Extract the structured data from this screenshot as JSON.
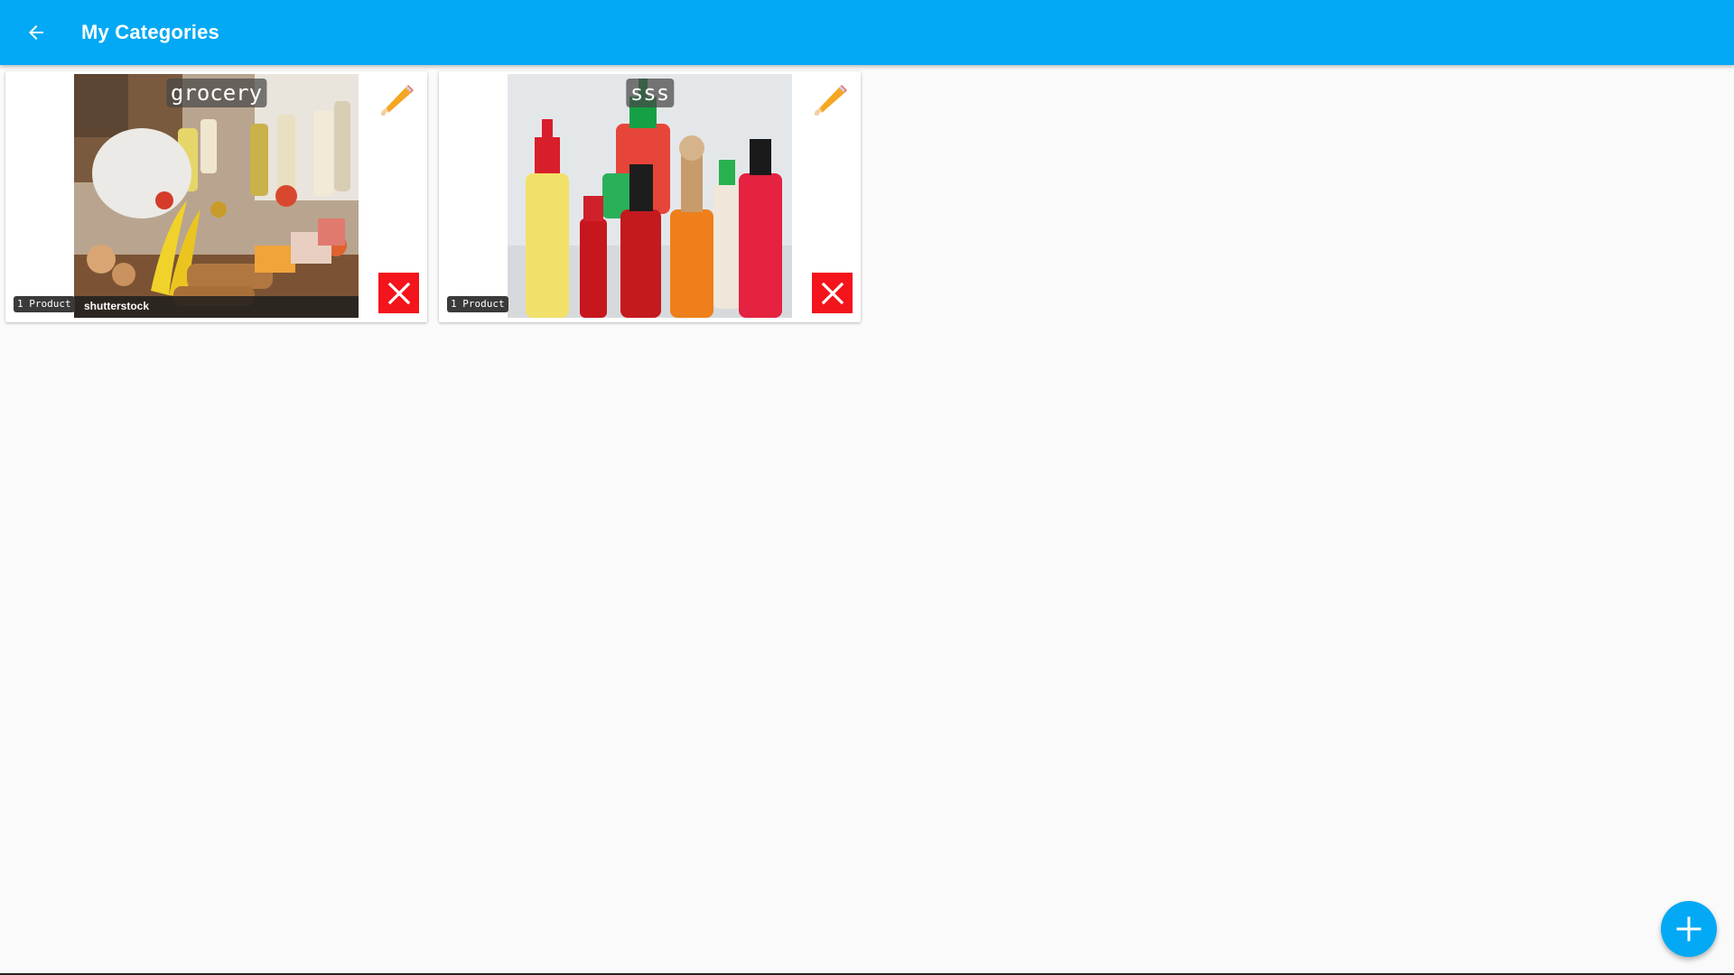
{
  "appbar": {
    "title": "My Categories",
    "back_icon": "arrow-back-icon",
    "color": "#03a9f4"
  },
  "categories": [
    {
      "name": "grocery",
      "count_label": "1 Product",
      "watermark": "shutterstock",
      "edit_icon": "pencil-icon",
      "delete_icon": "close-icon"
    },
    {
      "name": "sss",
      "count_label": "1 Product",
      "edit_icon": "pencil-icon",
      "delete_icon": "close-icon"
    }
  ],
  "fab": {
    "icon": "plus-icon",
    "color": "#03a9f4"
  },
  "colors": {
    "delete": "#f3141c",
    "background": "#fafafa"
  }
}
